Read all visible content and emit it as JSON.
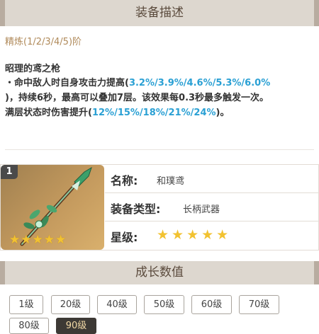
{
  "header": {
    "title": "装备描述"
  },
  "refinement": {
    "label": "精炼(1/2/3/4/5)阶"
  },
  "effect": {
    "name": "昭理的鸢之枪",
    "line1_prefix": "・命中敌人时自身攻击力提高(",
    "line1_values": "3.2%/3.9%/4.6%/5.3%/6.0%",
    "line2": ")，持续6秒，最高可以叠加7层。该效果每0.3秒最多触发一次。",
    "line3_prefix": "满层状态时伤害提升(",
    "line3_values": "12%/15%/18%/21%/24%",
    "line3_suffix": ")。"
  },
  "weapon": {
    "level_badge": "1",
    "name_label": "名称:",
    "name_value": "和璞鸢",
    "type_label": "装备类型:",
    "type_value": "长柄武器",
    "rarity_label": "星级:",
    "rarity_stars": "★★★★★",
    "image_stars": "★★★★★"
  },
  "growth": {
    "title": "成长数值",
    "levels": [
      "1级",
      "20级",
      "40级",
      "50级",
      "60级",
      "70级",
      "80级",
      "90级"
    ],
    "selected": "90级"
  },
  "colors": {
    "highlight": "#2aa0d4",
    "refine": "#b08a5a",
    "star": "#f2c230",
    "header_bg": "#ddd7cf"
  }
}
